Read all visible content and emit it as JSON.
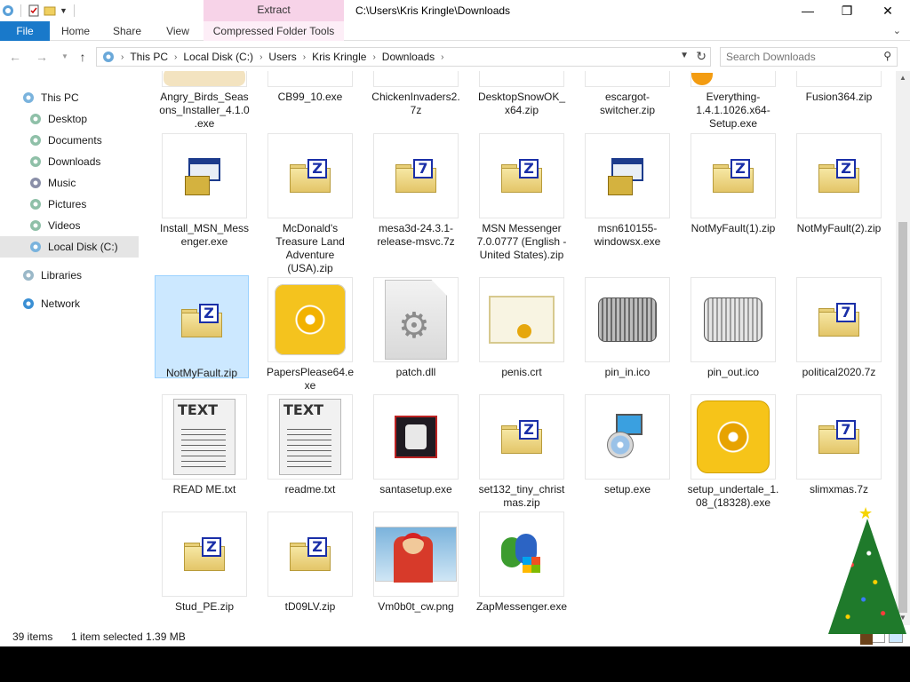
{
  "window": {
    "title": "C:\\Users\\Kris Kringle\\Downloads",
    "context_tab": "Extract",
    "controls": {
      "minimize": "—",
      "maximize": "❐",
      "close": "✕"
    }
  },
  "ribbon": {
    "tabs": [
      "File",
      "Home",
      "Share",
      "View",
      "Compressed Folder Tools"
    ]
  },
  "address": {
    "crumbs": [
      "This PC",
      "Local Disk (C:)",
      "Users",
      "Kris Kringle",
      "Downloads"
    ],
    "search_placeholder": "Search Downloads"
  },
  "nav": {
    "items": [
      {
        "label": "This PC",
        "icon": "computer-icon"
      },
      {
        "label": "Desktop",
        "icon": "desktop-icon"
      },
      {
        "label": "Documents",
        "icon": "documents-icon"
      },
      {
        "label": "Downloads",
        "icon": "downloads-icon"
      },
      {
        "label": "Music",
        "icon": "music-icon"
      },
      {
        "label": "Pictures",
        "icon": "pictures-icon"
      },
      {
        "label": "Videos",
        "icon": "videos-icon"
      },
      {
        "label": "Local Disk (C:)",
        "icon": "drive-icon"
      },
      {
        "label": "Libraries",
        "icon": "libraries-icon"
      },
      {
        "label": "Network",
        "icon": "network-icon"
      }
    ],
    "selected": "Local Disk (C:)"
  },
  "files": [
    {
      "name": "Angry_Birds_Seasons_Installer_4.1.0.exe",
      "type": "banner"
    },
    {
      "name": "CB99_10.exe",
      "type": "blank"
    },
    {
      "name": "ChickenInvaders2.7z",
      "type": "blank"
    },
    {
      "name": "DesktopSnowOK_x64.zip",
      "type": "blank"
    },
    {
      "name": "escargot-switcher.zip",
      "type": "blank"
    },
    {
      "name": "Everything-1.4.1.1026.x64-Setup.exe",
      "type": "orange"
    },
    {
      "name": "Fusion364.zip",
      "type": "blank"
    },
    {
      "name": "Install_MSN_Messenger.exe",
      "type": "exe"
    },
    {
      "name": "McDonald's Treasure Land Adventure (USA).zip",
      "type": "zip"
    },
    {
      "name": "mesa3d-24.3.1-release-msvc.7z",
      "type": "7z"
    },
    {
      "name": "MSN Messenger 7.0.0777 (English - United States).zip",
      "type": "zip"
    },
    {
      "name": "msn610155-windowsx.exe",
      "type": "exe"
    },
    {
      "name": "NotMyFault(1).zip",
      "type": "zip"
    },
    {
      "name": "NotMyFault(2).zip",
      "type": "zip"
    },
    {
      "name": "NotMyFault.zip",
      "type": "zip",
      "selected": true
    },
    {
      "name": "PapersPlease64.exe",
      "type": "cd"
    },
    {
      "name": "patch.dll",
      "type": "dll"
    },
    {
      "name": "penis.crt",
      "type": "crt"
    },
    {
      "name": "pin_in.ico",
      "type": "drum"
    },
    {
      "name": "pin_out.ico",
      "type": "drum-lite"
    },
    {
      "name": "political2020.7z",
      "type": "7z"
    },
    {
      "name": "READ ME.txt",
      "type": "txt"
    },
    {
      "name": "readme.txt",
      "type": "txt"
    },
    {
      "name": "santasetup.exe",
      "type": "santa"
    },
    {
      "name": "set132_tiny_christmas.zip",
      "type": "zip"
    },
    {
      "name": "setup.exe",
      "type": "setup"
    },
    {
      "name": "setup_undertale_1.08_(18328).exe",
      "type": "cd2"
    },
    {
      "name": "slimxmas.7z",
      "type": "7z"
    },
    {
      "name": "Stud_PE.zip",
      "type": "zip"
    },
    {
      "name": "tD09LV.zip",
      "type": "zip"
    },
    {
      "name": "Vm0b0t_cw.png",
      "type": "png"
    },
    {
      "name": "ZapMessenger.exe",
      "type": "msn"
    }
  ],
  "status": {
    "count": "39 items",
    "selection": "1 item selected  1.39 MB"
  },
  "icons": {
    "txt_word": "TEXT",
    "zip_letter": "Z",
    "sevenz_letter": "7"
  },
  "colors": {
    "file_tab": "#1979ca",
    "context_tab": "#f7d3e8",
    "selection": "#cce8ff"
  }
}
